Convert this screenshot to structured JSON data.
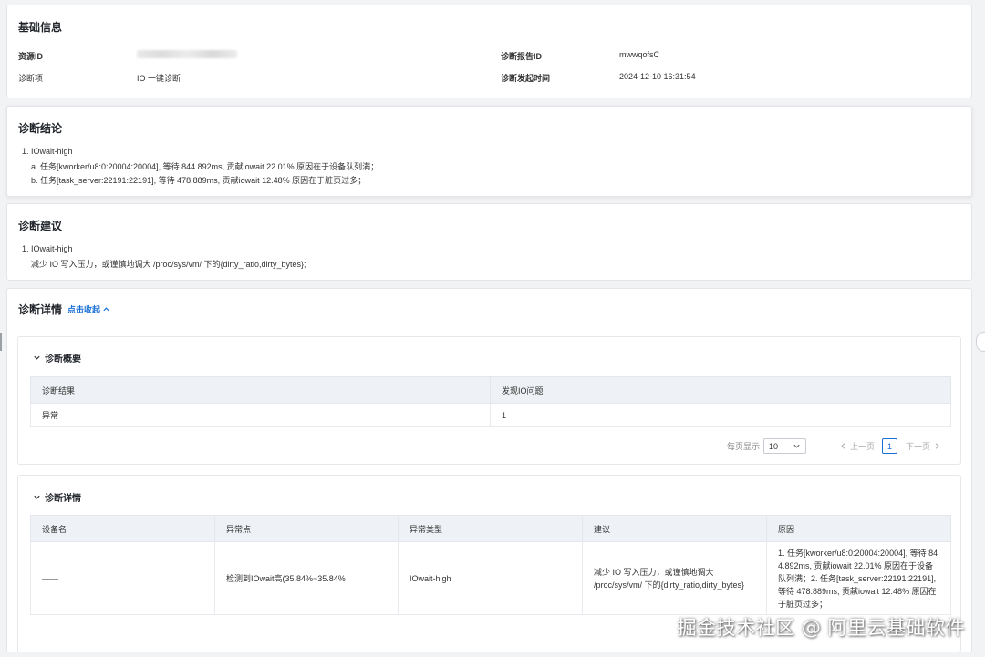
{
  "basic": {
    "title": "基础信息",
    "resource_id_label": "资源ID",
    "report_id_label": "诊断报告ID",
    "report_id_value": "mwwqofsC",
    "item_label": "诊断项",
    "item_value": "IO 一键诊断",
    "time_label": "诊断发起时间",
    "time_value": "2024-12-10 16:31:54"
  },
  "conclusion": {
    "title": "诊断结论",
    "line1": "1. IOwait-high",
    "line2": "a. 任务[kworker/u8:0:20004:20004], 等待 844.892ms, 贡献iowait 22.01% 原因在于设备队列满；",
    "line3": "b. 任务[task_server:22191:22191], 等待 478.889ms, 贡献iowait 12.48% 原因在于脏页过多；"
  },
  "suggestion": {
    "title": "诊断建议",
    "line1": "1. IOwait-high",
    "line2": "减少 IO 写入压力，或谨慎地调大 /proc/sys/vm/ 下的{dirty_ratio,dirty_bytes};"
  },
  "details": {
    "title": "诊断详情",
    "collapse_link": "点击收起",
    "overview": {
      "title": "诊断概要",
      "columns": [
        "诊断结果",
        "发现IO问题"
      ],
      "rows": [
        [
          "异常",
          "1"
        ]
      ],
      "pager": {
        "per_page_label": "每页显示",
        "per_page_value": "10",
        "prev": "上一页",
        "current": "1",
        "next": "下一页"
      }
    },
    "detail_table": {
      "title": "诊断详情",
      "columns": [
        "设备名",
        "异常点",
        "异常类型",
        "建议",
        "原因"
      ],
      "row": {
        "device": "——",
        "point": "检测到IOwait高(35.84%~35.84%",
        "type": "IOwait-high",
        "advice": "减少 IO 写入压力，或谨慎地调大 /proc/sys/vm/ 下的{dirty_ratio,dirty_bytes}",
        "reason": "1. 任务[kworker/u8:0:20004:20004], 等待 844.892ms, 贡献iowait 22.01% 原因在于设备队列满；2. 任务[task_server:22191:22191], 等待 478.889ms, 贡献iowait 12.48% 原因在于脏页过多；"
      }
    }
  },
  "watermark": "掘金技术社区 @ 阿里云基础软件",
  "colors": {
    "accent": "#1a6fd6",
    "header_bg": "#eef1f5",
    "page_bg": "#f2f3f5"
  }
}
